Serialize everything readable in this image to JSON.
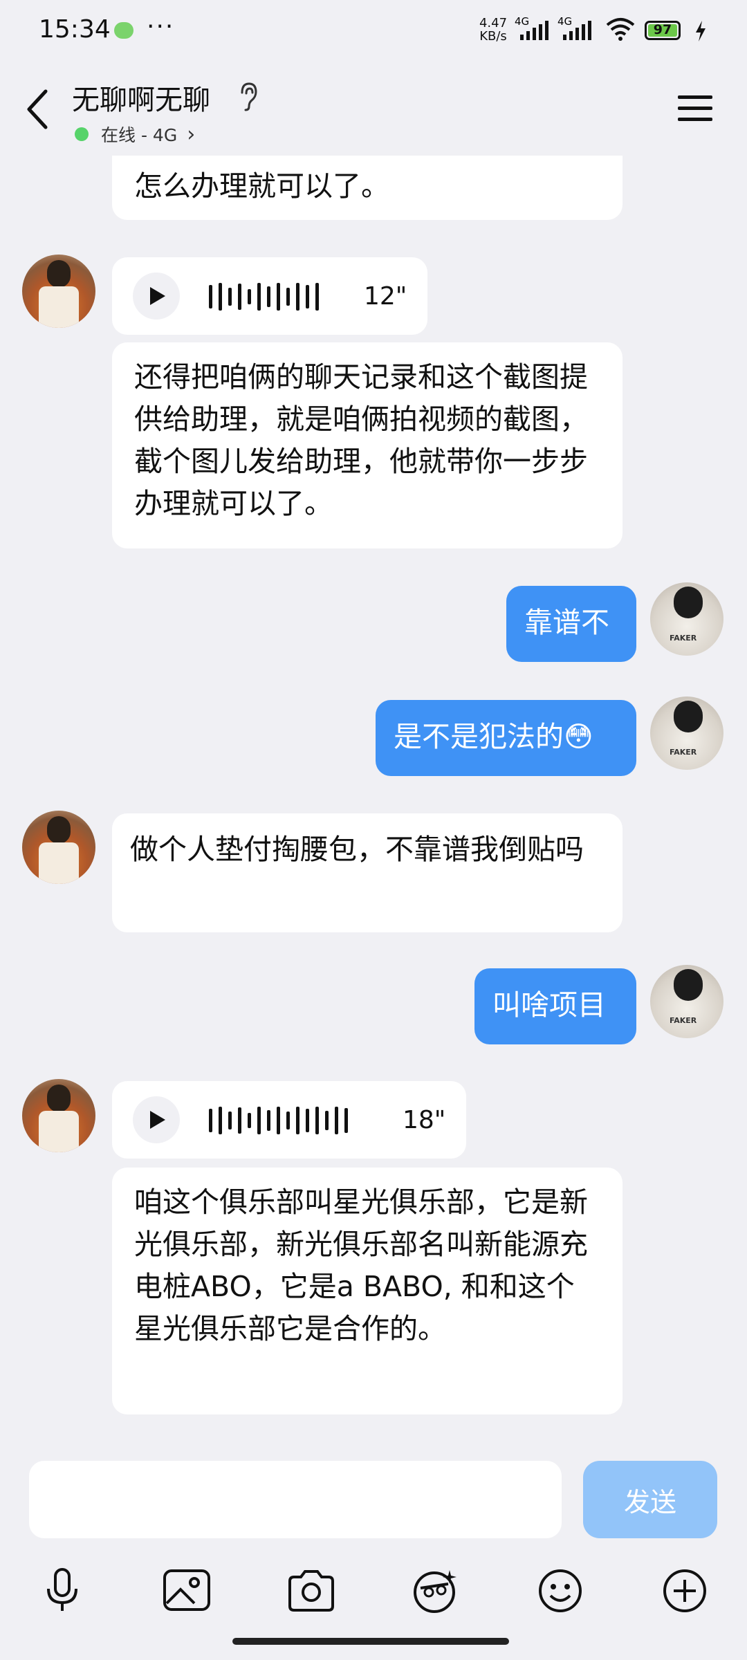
{
  "status": {
    "time": "15:34",
    "dots": "···",
    "speed": "4.47 KB/s",
    "net1": "4G",
    "net2": "4G",
    "battery": "97"
  },
  "header": {
    "title": "无聊啊无聊",
    "status": "在线 - 4G",
    "status_chevron": "›"
  },
  "messages": {
    "top_fragment": "怎么办理就可以了。",
    "voice1_duration": "12\"",
    "msg1": "还得把咱俩的聊天记录和这个截图提供给助理，就是咱俩拍视频的截图，截个图儿发给助理，他就带你一步步办理就可以了。",
    "me1": "靠谱不",
    "me2": "是不是犯法的😳",
    "msg2": "做个人垫付掏腰包，不靠谱我倒贴吗",
    "me3": "叫啥项目",
    "voice2_duration": "18\"",
    "msg3": "咱这个俱乐部叫星光俱乐部，它是新光俱乐部，新光俱乐部名叫新能源充电桩ABO，它是a BABO, 和和这个星光俱乐部它是合作的。"
  },
  "composer": {
    "input_value": "",
    "send_label": "发送"
  },
  "icons": {
    "back": "back-arrow-icon",
    "ear": "ear-icon",
    "menu": "menu-icon",
    "mic": "microphone-icon",
    "image": "image-icon",
    "camera": "camera-icon",
    "sticker": "sticker-icon",
    "emoji": "emoji-icon",
    "plus": "plus-icon"
  },
  "colors": {
    "my_bubble": "#3f92f5",
    "their_bubble": "#ffffff",
    "background": "#f0f0f4",
    "send_disabled": "#92c4f9"
  }
}
